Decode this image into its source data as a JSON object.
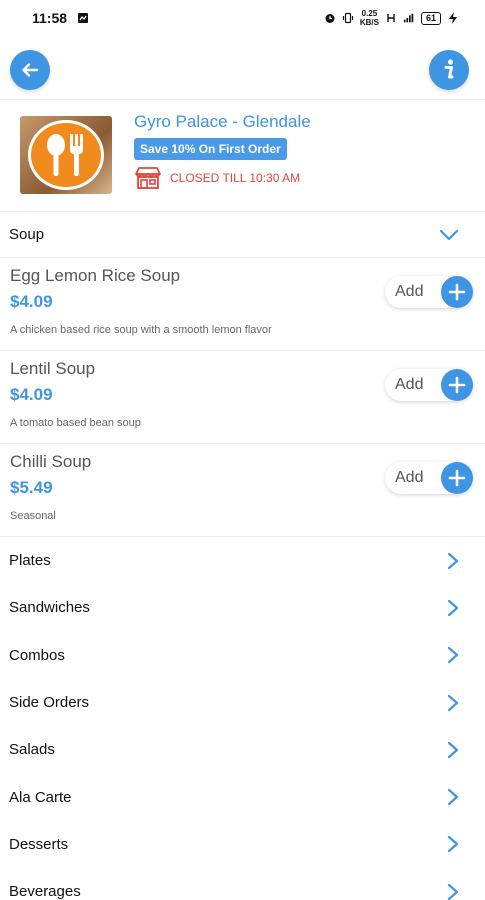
{
  "status_bar": {
    "time": "11:58",
    "network_text": "0.25\nKB/S",
    "battery": "61"
  },
  "restaurant": {
    "name": "Gyro Palace - Glendale",
    "promo": "Save 10% On First Order",
    "status": "CLOSED TILL 10:30 AM"
  },
  "section": {
    "title": "Soup"
  },
  "items": [
    {
      "name": "Egg Lemon Rice Soup",
      "price": "$4.09",
      "description": "A chicken based rice soup with a smooth lemon flavor",
      "add_label": "Add"
    },
    {
      "name": "Lentil Soup",
      "price": "$4.09",
      "description": "A tomato based bean soup",
      "add_label": "Add"
    },
    {
      "name": "Chilli Soup",
      "price": "$5.49",
      "description": "Seasonal",
      "add_label": "Add"
    }
  ],
  "categories": [
    {
      "label": "Plates"
    },
    {
      "label": "Sandwiches"
    },
    {
      "label": "Combos"
    },
    {
      "label": "Side Orders"
    },
    {
      "label": "Salads"
    },
    {
      "label": "Ala Carte"
    },
    {
      "label": "Desserts"
    },
    {
      "label": "Beverages"
    }
  ],
  "colors": {
    "accent": "#3d95e3",
    "closed": "#e0453c",
    "logo_orange": "#f08a1c"
  },
  "icons": {
    "back": "arrow-left-icon",
    "info": "info-icon",
    "store": "store-icon",
    "expand": "chevron-down-icon",
    "category": "chevron-right-icon",
    "add": "plus-icon"
  }
}
